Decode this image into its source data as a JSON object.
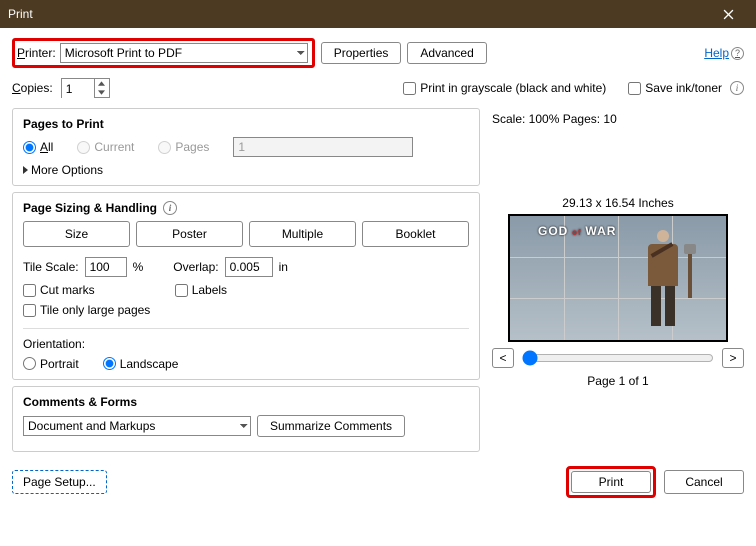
{
  "window": {
    "title": "Print"
  },
  "toolbar": {
    "printer_label": "Printer:",
    "printer_value": "Microsoft Print to PDF",
    "properties": "Properties",
    "advanced": "Advanced",
    "help": "Help"
  },
  "copies": {
    "label": "Copies:",
    "value": "1",
    "grayscale": "Print in grayscale (black and white)",
    "save_ink": "Save ink/toner"
  },
  "pages_to_print": {
    "title": "Pages to Print",
    "all": "All",
    "current": "Current",
    "pages": "Pages",
    "range_value": "1",
    "more": "More Options"
  },
  "sizing": {
    "title": "Page Sizing & Handling",
    "size": "Size",
    "poster": "Poster",
    "multiple": "Multiple",
    "booklet": "Booklet",
    "tile_scale_label": "Tile Scale:",
    "tile_scale_value": "100",
    "percent": "%",
    "overlap_label": "Overlap:",
    "overlap_value": "0.005",
    "overlap_unit": "in",
    "cut_marks": "Cut marks",
    "labels": "Labels",
    "tile_only": "Tile only large pages"
  },
  "orientation": {
    "title": "Orientation:",
    "portrait": "Portrait",
    "landscape": "Landscape"
  },
  "comments": {
    "title": "Comments & Forms",
    "value": "Document and Markups",
    "summarize": "Summarize Comments"
  },
  "preview": {
    "scale_pages": "Scale: 100% Pages: 10",
    "dims": "29.13 x 16.54 Inches",
    "logo_top": "GOD",
    "logo_mid": "of",
    "logo_bot": "WAR",
    "prev": "<",
    "next": ">",
    "page_label": "Page 1 of 1"
  },
  "footer": {
    "page_setup": "Page Setup...",
    "print": "Print",
    "cancel": "Cancel"
  }
}
